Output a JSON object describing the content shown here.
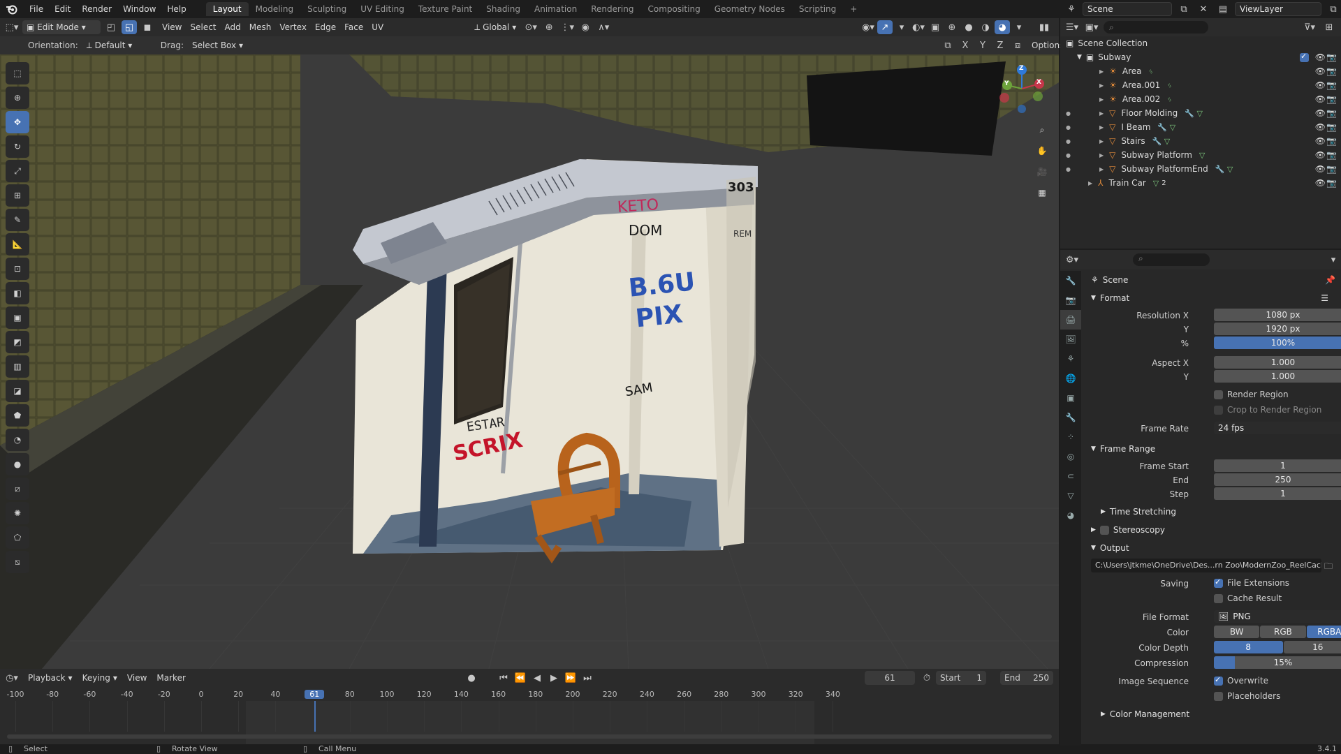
{
  "app": {
    "version": "3.4.1"
  },
  "menu": [
    "File",
    "Edit",
    "Render",
    "Window",
    "Help"
  ],
  "workspaces": [
    "Layout",
    "Modeling",
    "Sculpting",
    "UV Editing",
    "Texture Paint",
    "Shading",
    "Animation",
    "Rendering",
    "Compositing",
    "Geometry Nodes",
    "Scripting"
  ],
  "workspace_add": "+",
  "scene_name": "Scene",
  "view_layer": "ViewLayer",
  "viewport_header": {
    "mode": "Edit Mode",
    "menus": [
      "View",
      "Select",
      "Add",
      "Mesh",
      "Vertex",
      "Edge",
      "Face",
      "UV"
    ],
    "transform_orientation": "Global"
  },
  "tool_header": {
    "orientation_label": "Orientation:",
    "orientation_value": "Default",
    "drag_label": "Drag:",
    "drag_value": "Select Box",
    "axes": [
      "X",
      "Y",
      "Z"
    ],
    "options": "Options"
  },
  "gizmo": {
    "x": "X",
    "y": "Y",
    "z": "Z"
  },
  "model_text": {
    "car_number": "303",
    "car_label": "REM"
  },
  "graffiti": [
    "KETO",
    "DOM",
    "SCRIX",
    "B.6U",
    "PIX",
    "SAM",
    "ESTAR"
  ],
  "outliner": {
    "root": "Scene Collection",
    "collection": "Subway",
    "items": [
      "Area",
      "Area.001",
      "Area.002",
      "Floor Molding",
      "I Beam",
      "Stairs",
      "Subway Platform",
      "Subway PlatformEnd",
      "Train Car"
    ],
    "train_car_count": "2"
  },
  "properties": {
    "context": "Scene",
    "format_title": "Format",
    "resolution_x_label": "Resolution X",
    "resolution_x": "1080 px",
    "resolution_y_label": "Y",
    "resolution_y": "1920 px",
    "percent_label": "%",
    "percent": "100%",
    "percent_fraction": 1.0,
    "aspect_x_label": "Aspect X",
    "aspect_x": "1.000",
    "aspect_y_label": "Y",
    "aspect_y": "1.000",
    "render_region": "Render Region",
    "crop_region": "Crop to Render Region",
    "frame_rate_label": "Frame Rate",
    "frame_rate": "24 fps",
    "frame_range_title": "Frame Range",
    "frame_start_label": "Frame Start",
    "frame_start": "1",
    "end_label": "End",
    "end": "250",
    "step_label": "Step",
    "step": "1",
    "time_stretching": "Time Stretching",
    "stereoscopy": "Stereoscopy",
    "output_title": "Output",
    "output_path": "C:\\Users\\jtkme\\OneDrive\\Des...rn Zoo\\ModernZoo_ReelCache\\",
    "saving_label": "Saving",
    "file_extensions": "File Extensions",
    "cache_result": "Cache Result",
    "file_format_label": "File Format",
    "file_format": "PNG",
    "color_label": "Color",
    "color_options": [
      "BW",
      "RGB",
      "RGBA"
    ],
    "color_selected": "RGBA",
    "color_depth_label": "Color Depth",
    "color_depth_options": [
      "8",
      "16"
    ],
    "compression_label": "Compression",
    "compression": "15%",
    "compression_fraction": 0.15,
    "image_sequence_label": "Image Sequence",
    "overwrite": "Overwrite",
    "placeholders": "Placeholders",
    "color_management": "Color Management"
  },
  "timeline": {
    "menus": [
      "Playback",
      "Keying",
      "View",
      "Marker"
    ],
    "current_frame": "61",
    "start_label": "Start",
    "start": "1",
    "end_label": "End",
    "end": "250",
    "ticks": [
      "-100",
      "-80",
      "-60",
      "-40",
      "-20",
      "0",
      "20",
      "40",
      "61",
      "80",
      "100",
      "120",
      "140",
      "160",
      "180",
      "200",
      "220",
      "240",
      "260",
      "280",
      "300",
      "320",
      "340"
    ]
  },
  "status": {
    "select": "Select",
    "rotate": "Rotate View",
    "call_menu": "Call Menu",
    "version": "3.4.1"
  },
  "colors": {
    "accent": "#4772b3",
    "bg": "#1d1d1d",
    "panel": "#282828",
    "field": "#545454"
  }
}
